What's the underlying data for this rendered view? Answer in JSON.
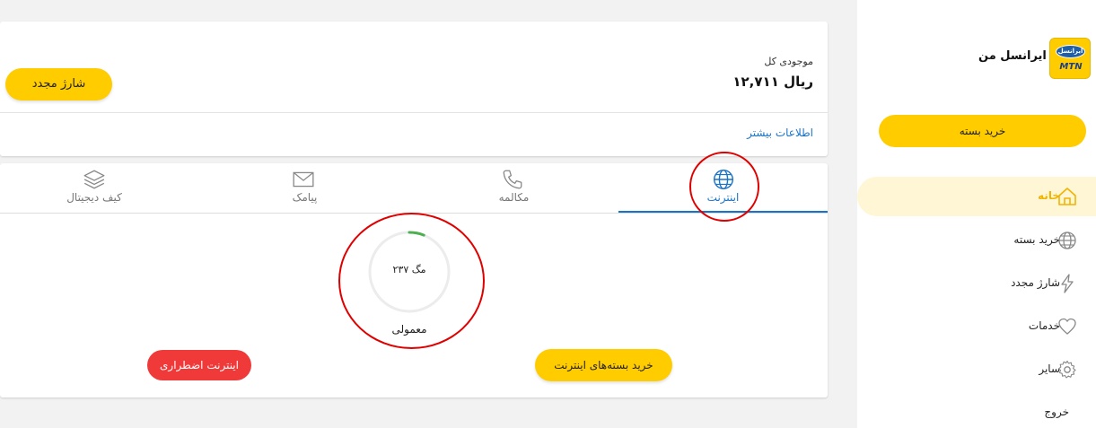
{
  "brand": {
    "title": "ایرانسل من",
    "logo_text": "ایرانسل",
    "logo_sub": "MTN",
    "color": "#ffcc00"
  },
  "sidebar": {
    "buy_package": "خرید بسته",
    "items": [
      {
        "label": "خانه",
        "icon": "home-icon",
        "active": true
      },
      {
        "label": "خرید بسته",
        "icon": "globe-icon",
        "active": false
      },
      {
        "label": "شارژ مجدد",
        "icon": "lightning-icon",
        "active": false
      },
      {
        "label": "خدمات",
        "icon": "heart-icon",
        "active": false
      },
      {
        "label": "سایر",
        "icon": "gear-icon",
        "active": false
      },
      {
        "label": "خروج",
        "icon": "",
        "active": false
      }
    ]
  },
  "balance": {
    "label": "موجودی کل",
    "value": "۱۲,۷۱۱ ریال",
    "recharge": "شارژ مجدد",
    "more_info": "اطلاعات بیشتر"
  },
  "tabs": [
    {
      "label": "اینترنت",
      "icon": "globe-icon",
      "active": true
    },
    {
      "label": "مکالمه",
      "icon": "phone-icon",
      "active": false
    },
    {
      "label": "پیامک",
      "icon": "envelope-icon",
      "active": false
    },
    {
      "label": "کیف دیجیتال",
      "icon": "layers-icon",
      "active": false
    }
  ],
  "internet": {
    "remaining": "۲۳۷ مگ",
    "plan_type": "معمولی",
    "used_fraction": 0.06,
    "buy_packages": "خرید بسته‌های اینترنت",
    "emergency": "اینترنت اضطراری"
  },
  "colors": {
    "accent": "#ffcc00",
    "link": "#1a73c7",
    "danger": "#f03a3a",
    "gauge": "#4caf50",
    "annotation": "#e00000"
  }
}
